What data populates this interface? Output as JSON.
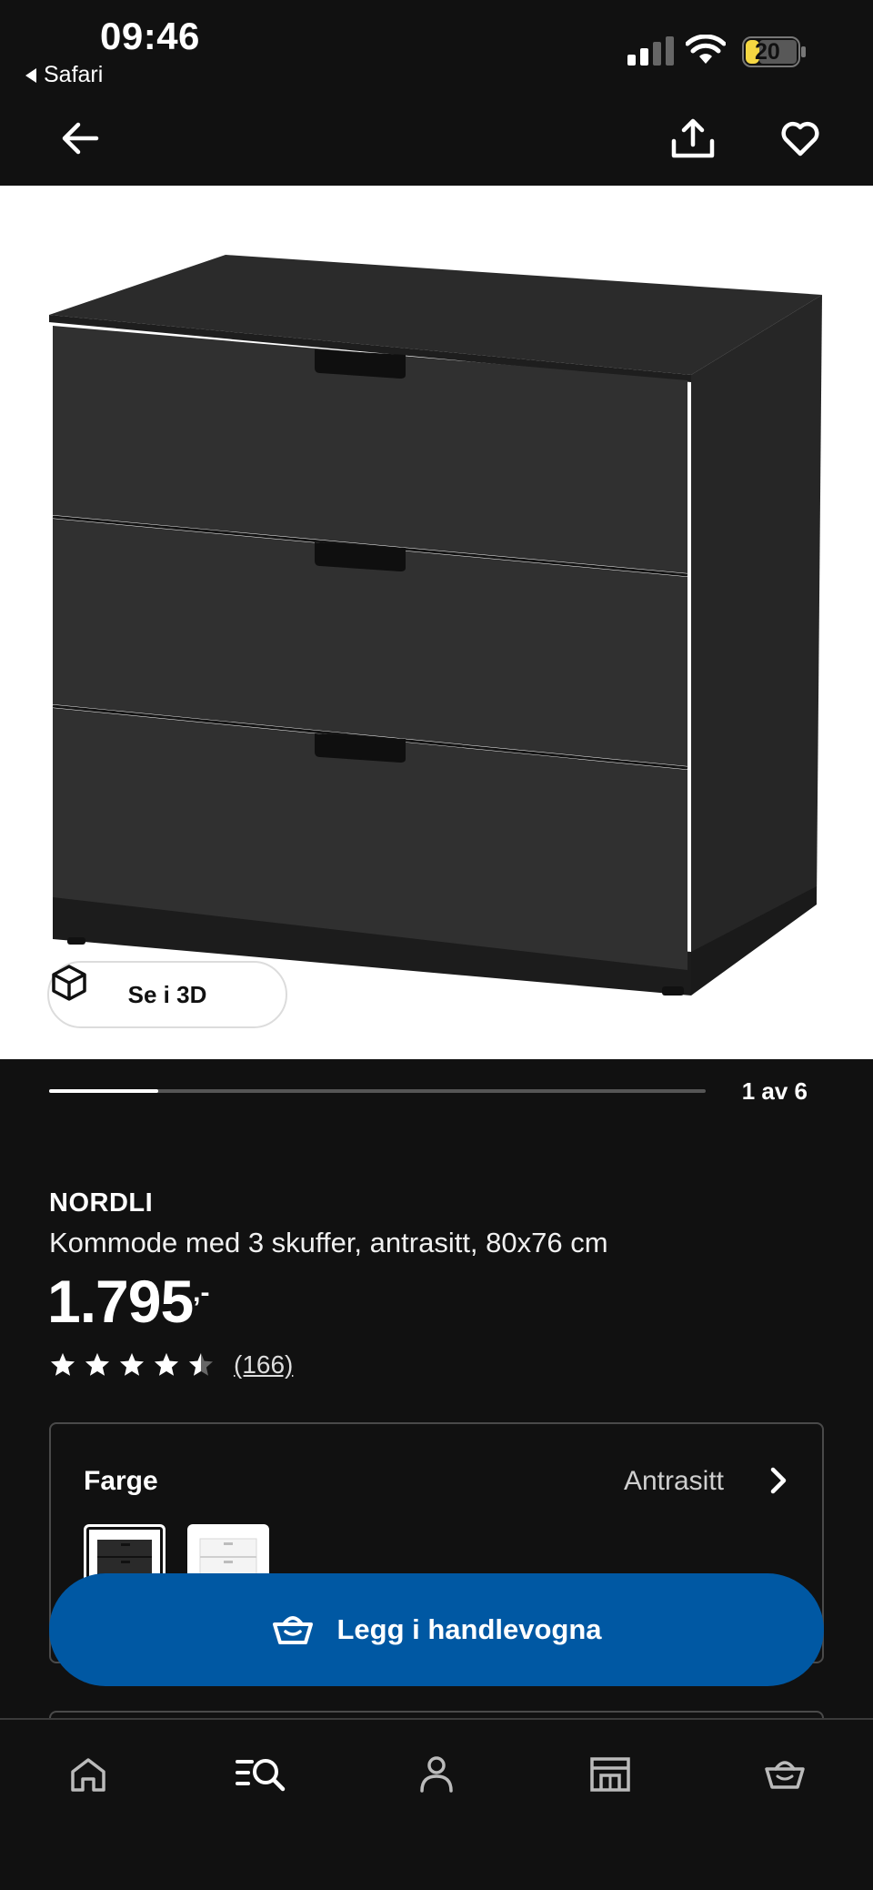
{
  "status_bar": {
    "time": "09:46",
    "back_app": "Safari",
    "battery": "20"
  },
  "nav": {
    "back_icon": "arrow-left-icon",
    "share_icon": "share-icon",
    "favorite_icon": "heart-icon"
  },
  "gallery": {
    "view_3d_label": "Se i 3D",
    "pager_label": "1 av 6",
    "current_index": 1,
    "total": 6
  },
  "product": {
    "brand": "NORDLI",
    "description": "Kommode med 3 skuffer, antrasitt, 80x76 cm",
    "price_main": "1.795",
    "price_suffix": ",-",
    "rating_value": 4.5,
    "rating_count": "(166)"
  },
  "color_selector": {
    "label": "Farge",
    "selected_value": "Antrasitt",
    "options": [
      "Antrasitt",
      "Hvit"
    ]
  },
  "actions": {
    "add_to_cart_label": "Legg i handlevogna"
  },
  "tab_bar": {
    "items": [
      "home-icon",
      "search-list-icon",
      "profile-icon",
      "store-icon",
      "cart-icon"
    ]
  },
  "colors": {
    "background": "#111111",
    "primary_button": "#0058a3",
    "battery_fill": "#f5d742",
    "dresser": "#2a2a2a"
  }
}
